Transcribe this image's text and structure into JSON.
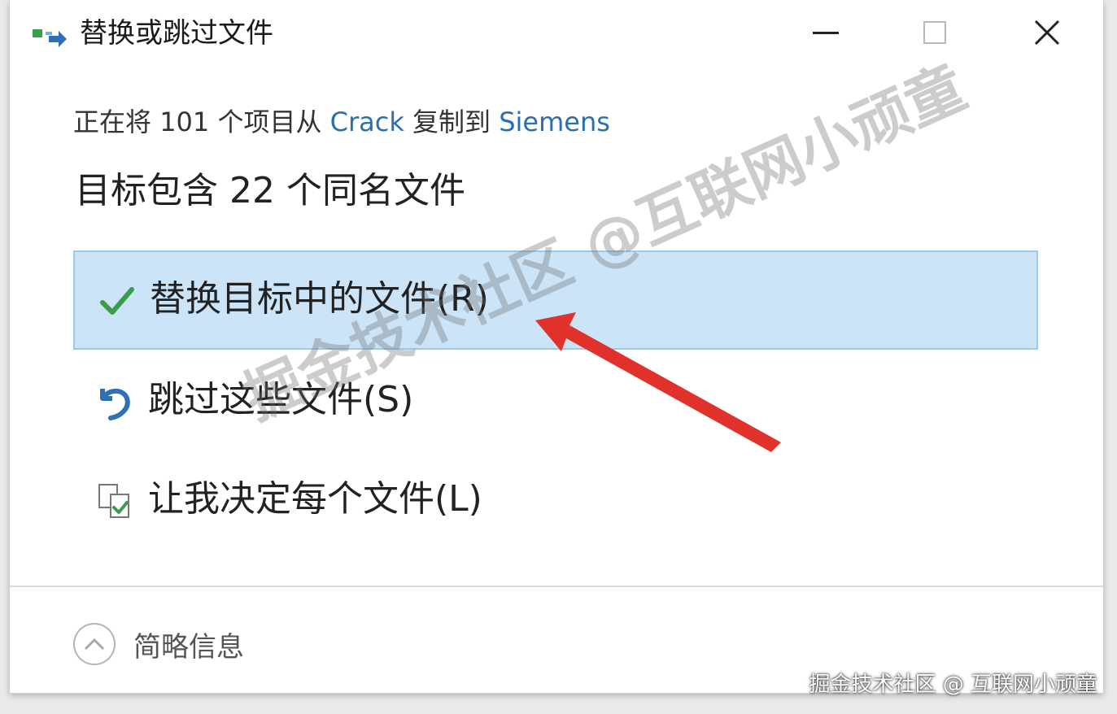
{
  "window": {
    "title": "替换或跳过文件",
    "icon": "file-copy-icon"
  },
  "copy_info": {
    "prefix": "正在将",
    "count": "101",
    "middle": "个项目从",
    "source": "Crack",
    "action": "复制到",
    "destination": "Siemens"
  },
  "heading": "目标包含 22 个同名文件",
  "options": [
    {
      "label": "替换目标中的文件(R)",
      "icon": "check-icon",
      "selected": true
    },
    {
      "label": "跳过这些文件(S)",
      "icon": "skip-arrow-icon",
      "selected": false
    },
    {
      "label": "让我决定每个文件(L)",
      "icon": "decide-files-icon",
      "selected": false
    }
  ],
  "footer": {
    "details_label": "简略信息",
    "icon": "chevron-up-icon"
  },
  "watermarks": {
    "diagonal": "掘金技术社区 @互联网小顽童",
    "corner": "掘金技术社区 @ 互联网小顽童"
  },
  "colors": {
    "link": "#2a6fb0",
    "selected_bg": "#cce4f7",
    "selected_border": "#99c9ef",
    "check": "#3a9b4d",
    "skip": "#2f6fb8",
    "arrow": "#e0312a"
  }
}
